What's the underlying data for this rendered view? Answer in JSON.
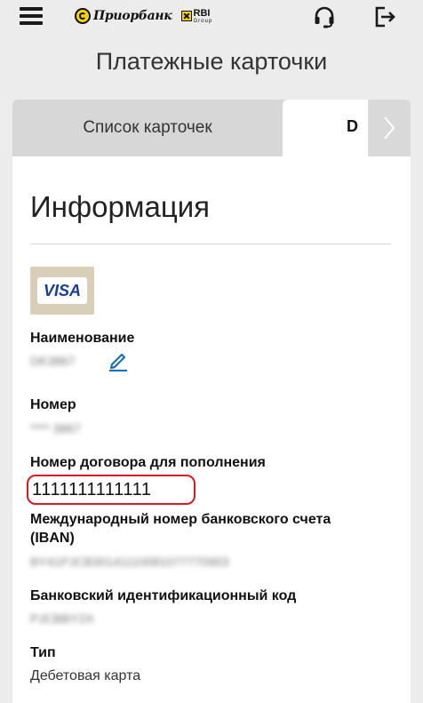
{
  "header": {
    "brand": "Приорбанк",
    "group_logo": "RBI",
    "group_sub": "Group",
    "icons": [
      "menu-icon",
      "headset-icon",
      "logout-icon"
    ]
  },
  "page": {
    "title": "Платежные карточки"
  },
  "tabs": {
    "list_label": "Список карточек",
    "active_label": "D"
  },
  "info": {
    "title": "Информация",
    "card_brand": "VISA",
    "fields": {
      "name_label": "Наименование",
      "name_value": "DK3867",
      "number_label": "Номер",
      "number_value": "**** 3867",
      "contract_label": "Номер договора для пополнения",
      "contract_value": "1111111111111",
      "iban_label_1": "Международный номер банковского счета",
      "iban_label_2": "(IBAN)",
      "iban_value": "BY41PJCB30141110081077770903",
      "bic_label": "Банковский идентификационный код",
      "bic_value": "PJCBBY2X",
      "type_label": "Тип",
      "type_value": "Дебетовая карта"
    }
  },
  "colors": {
    "accent_red": "#d71920",
    "link_blue": "#1a6fb8",
    "brand_yellow": "#f5d20b"
  }
}
